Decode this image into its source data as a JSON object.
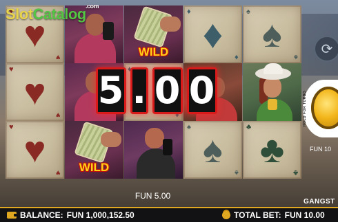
{
  "logo": {
    "part1": "Slot",
    "part2": "Catalog",
    "suffix": ".com"
  },
  "reels": [
    [
      {
        "type": "card",
        "suit": "heart",
        "glyph": "♥"
      },
      {
        "type": "card",
        "suit": "heart",
        "glyph": "♥"
      },
      {
        "type": "card",
        "suit": "heart",
        "glyph": "♥"
      }
    ],
    [
      {
        "type": "character"
      },
      {
        "type": "character"
      },
      {
        "type": "wild",
        "label": "WILD"
      }
    ],
    [
      {
        "type": "wild",
        "label": "WILD"
      },
      {
        "type": "card",
        "suit": "diamond",
        "glyph": "♦"
      },
      {
        "type": "character"
      }
    ],
    [
      {
        "type": "card",
        "suit": "diamond",
        "glyph": "♦"
      },
      {
        "type": "character"
      },
      {
        "type": "card",
        "suit": "spade",
        "glyph": "♠"
      }
    ],
    [
      {
        "type": "card",
        "suit": "spade",
        "glyph": "♠"
      },
      {
        "type": "character"
      },
      {
        "type": "card",
        "suit": "club",
        "glyph": "♣"
      }
    ]
  ],
  "win_display": {
    "amount": "5.00",
    "digits": [
      "5",
      ".",
      "0",
      "0"
    ]
  },
  "fun_win": "FUN 5.00",
  "side_panel": {
    "hold_text": "HOLD FOR TURBO",
    "bet_display": "FUN 10",
    "autoplay_icon": "refresh-icon",
    "spin_icon": "spin-icon"
  },
  "game_label": "GANGST",
  "bottom_bar": {
    "balance_label": "BALANCE:",
    "balance_value": "FUN 1,000,152.50",
    "total_bet_label": "TOTAL BET:",
    "total_bet_value": "FUN 10.00"
  },
  "colors": {
    "accent": "#e0a820",
    "win_frame": "#d81a1a",
    "wild_text": "#ffd21a"
  }
}
